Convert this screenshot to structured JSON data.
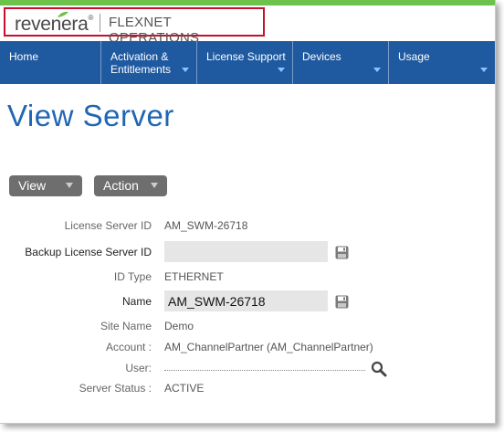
{
  "brand": {
    "logo_text": "revenera",
    "product": "FLEXNET OPERATIONS"
  },
  "nav": {
    "items": [
      {
        "label": "Home"
      },
      {
        "label": "Activation & Entitlements"
      },
      {
        "label": "License Support"
      },
      {
        "label": "Devices"
      },
      {
        "label": "Usage"
      }
    ]
  },
  "page": {
    "title": "View Server"
  },
  "toolbar": {
    "view_label": "View",
    "action_label": "Action"
  },
  "form": {
    "license_server_id": {
      "label": "License Server ID",
      "value": "AM_SWM-26718"
    },
    "backup_license_server_id": {
      "label": "Backup License Server ID",
      "value": ""
    },
    "id_type": {
      "label": "ID Type",
      "value": "ETHERNET"
    },
    "name": {
      "label": "Name",
      "value": "AM_SWM-26718"
    },
    "site_name": {
      "label": "Site Name",
      "value": "Demo"
    },
    "account": {
      "label": "Account :",
      "value": "AM_ChannelPartner (AM_ChannelPartner)"
    },
    "user": {
      "label": "User:",
      "value": ""
    },
    "server_status": {
      "label": "Server Status :",
      "value": "ACTIVE"
    }
  },
  "icons": {
    "save": "save-disk-icon",
    "search": "magnifier-icon",
    "caret": "caret-down-icon"
  },
  "colors": {
    "top_bar": "#6cc24a",
    "nav_bg": "#1f5aa0",
    "title": "#1f66b3",
    "logo_border": "#c8102e",
    "button_bg": "#6e6e6e"
  }
}
